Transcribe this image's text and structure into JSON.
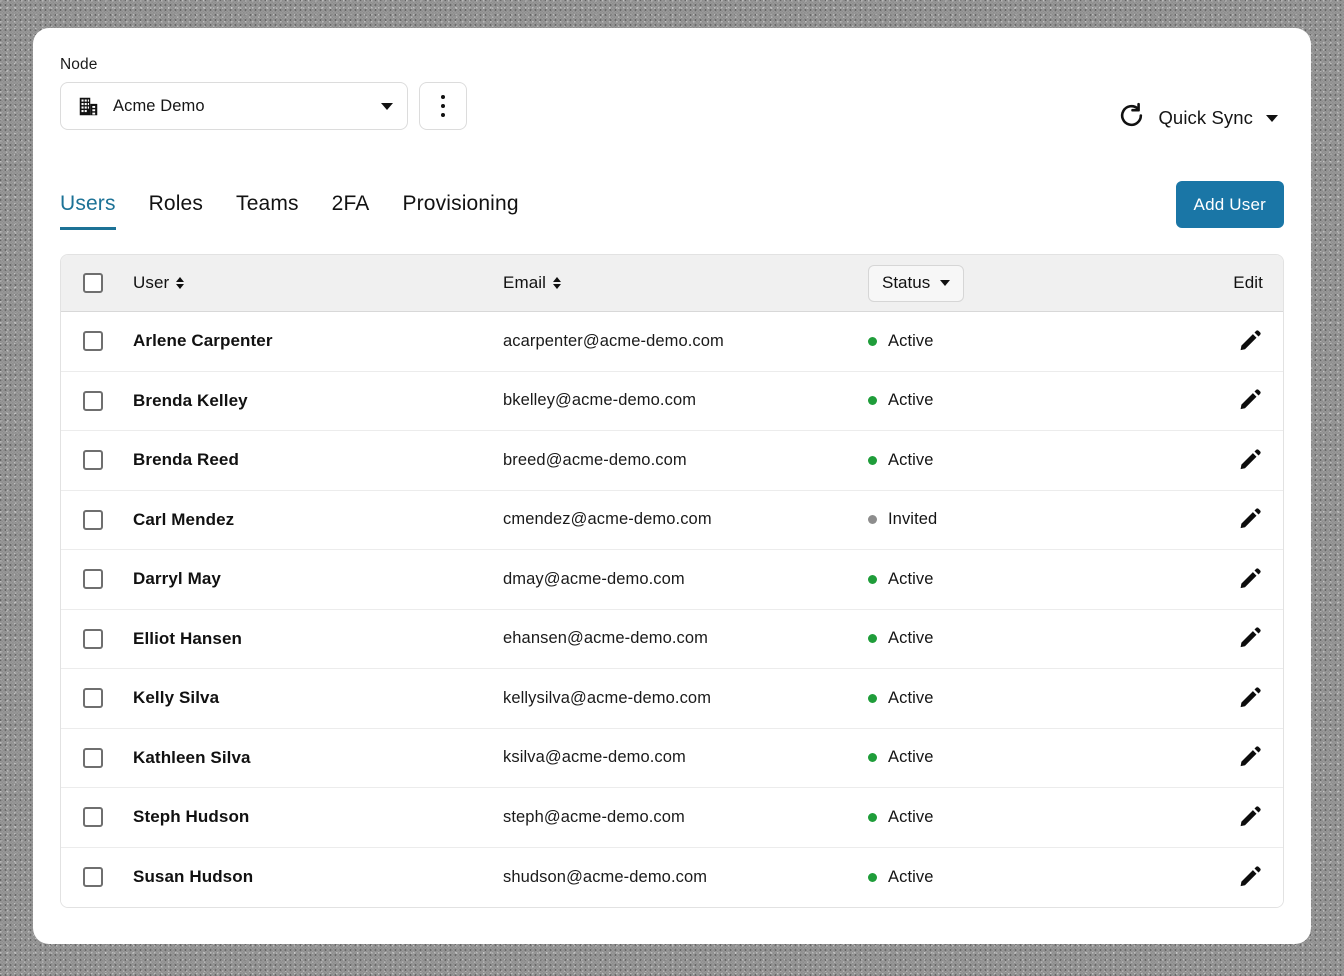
{
  "node": {
    "label": "Node",
    "selected": "Acme Demo",
    "icon": "building-icon",
    "caret_icon": "chevron-down-icon",
    "kebab_icon": "more-vertical-icon"
  },
  "quick_sync": {
    "label": "Quick Sync",
    "icon": "refresh-icon",
    "caret_icon": "chevron-down-icon"
  },
  "tabs": [
    {
      "label": "Users",
      "active": true
    },
    {
      "label": "Roles",
      "active": false
    },
    {
      "label": "Teams",
      "active": false
    },
    {
      "label": "2FA",
      "active": false
    },
    {
      "label": "Provisioning",
      "active": false
    }
  ],
  "add_user_button": "Add User",
  "table": {
    "headers": {
      "select_all": "",
      "user": "User",
      "email": "Email",
      "status": "Status",
      "edit": "Edit"
    },
    "rows": [
      {
        "name": "Arlene Carpenter",
        "email": "acarpenter@acme-demo.com",
        "status": "Active",
        "status_color": "#1f9d3a"
      },
      {
        "name": "Brenda Kelley",
        "email": "bkelley@acme-demo.com",
        "status": "Active",
        "status_color": "#1f9d3a"
      },
      {
        "name": "Brenda Reed",
        "email": "breed@acme-demo.com",
        "status": "Active",
        "status_color": "#1f9d3a"
      },
      {
        "name": "Carl Mendez",
        "email": "cmendez@acme-demo.com",
        "status": "Invited",
        "status_color": "#8d8d8d"
      },
      {
        "name": "Darryl May",
        "email": "dmay@acme-demo.com",
        "status": "Active",
        "status_color": "#1f9d3a"
      },
      {
        "name": "Elliot Hansen",
        "email": "ehansen@acme-demo.com",
        "status": "Active",
        "status_color": "#1f9d3a"
      },
      {
        "name": "Kelly Silva",
        "email": "kellysilva@acme-demo.com",
        "status": "Active",
        "status_color": "#1f9d3a"
      },
      {
        "name": "Kathleen Silva",
        "email": "ksilva@acme-demo.com",
        "status": "Active",
        "status_color": "#1f9d3a"
      },
      {
        "name": "Steph Hudson",
        "email": "steph@acme-demo.com",
        "status": "Active",
        "status_color": "#1f9d3a"
      },
      {
        "name": "Susan Hudson",
        "email": "shudson@acme-demo.com",
        "status": "Active",
        "status_color": "#1f9d3a"
      }
    ]
  },
  "colors": {
    "accent_tab": "#1c7296",
    "primary_button": "#1a76a6",
    "status_active": "#1f9d3a",
    "status_invited": "#8d8d8d"
  }
}
